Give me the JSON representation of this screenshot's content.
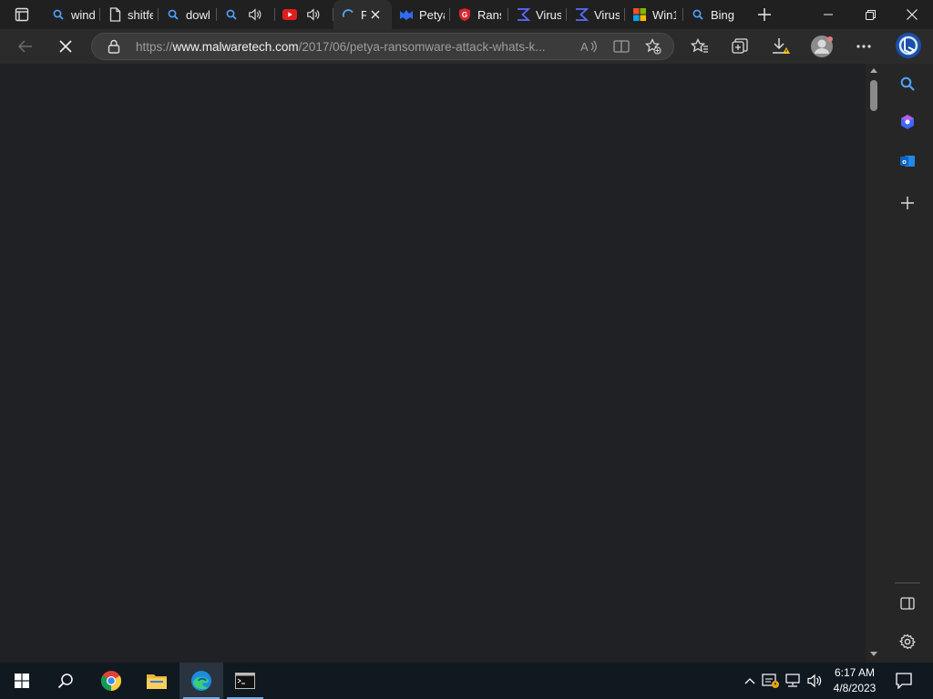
{
  "browser": {
    "tabs": [
      {
        "label": "wind",
        "icon": "search-icon"
      },
      {
        "label": "shitfe",
        "icon": "document-icon"
      },
      {
        "label": "dowl",
        "icon": "search-icon"
      },
      {
        "label": "",
        "icon": "search-icon",
        "audio": true
      },
      {
        "label": "",
        "icon": "youtube-icon",
        "audio": true
      },
      {
        "label": "F",
        "icon": "loading-icon",
        "active": true
      },
      {
        "label": "Petya",
        "icon": "malwarebytes-icon"
      },
      {
        "label": "Rans",
        "icon": "shield-icon"
      },
      {
        "label": "Virus",
        "icon": "sigma-icon"
      },
      {
        "label": "Virus",
        "icon": "sigma-icon"
      },
      {
        "label": "Win1",
        "icon": "windows-icon"
      },
      {
        "label": "Bing",
        "icon": "search-icon"
      }
    ],
    "address": {
      "prefix": "https://",
      "domain": "www.malwaretech.com",
      "path": "/2017/06/petya-ransomware-attack-whats-k..."
    },
    "colors": {
      "accent": "#2f7ce0",
      "page_bg": "#202124",
      "tabbar_bg": "#202020"
    }
  },
  "taskbar": {
    "time": "6:17 AM",
    "date": "4/8/2023"
  }
}
